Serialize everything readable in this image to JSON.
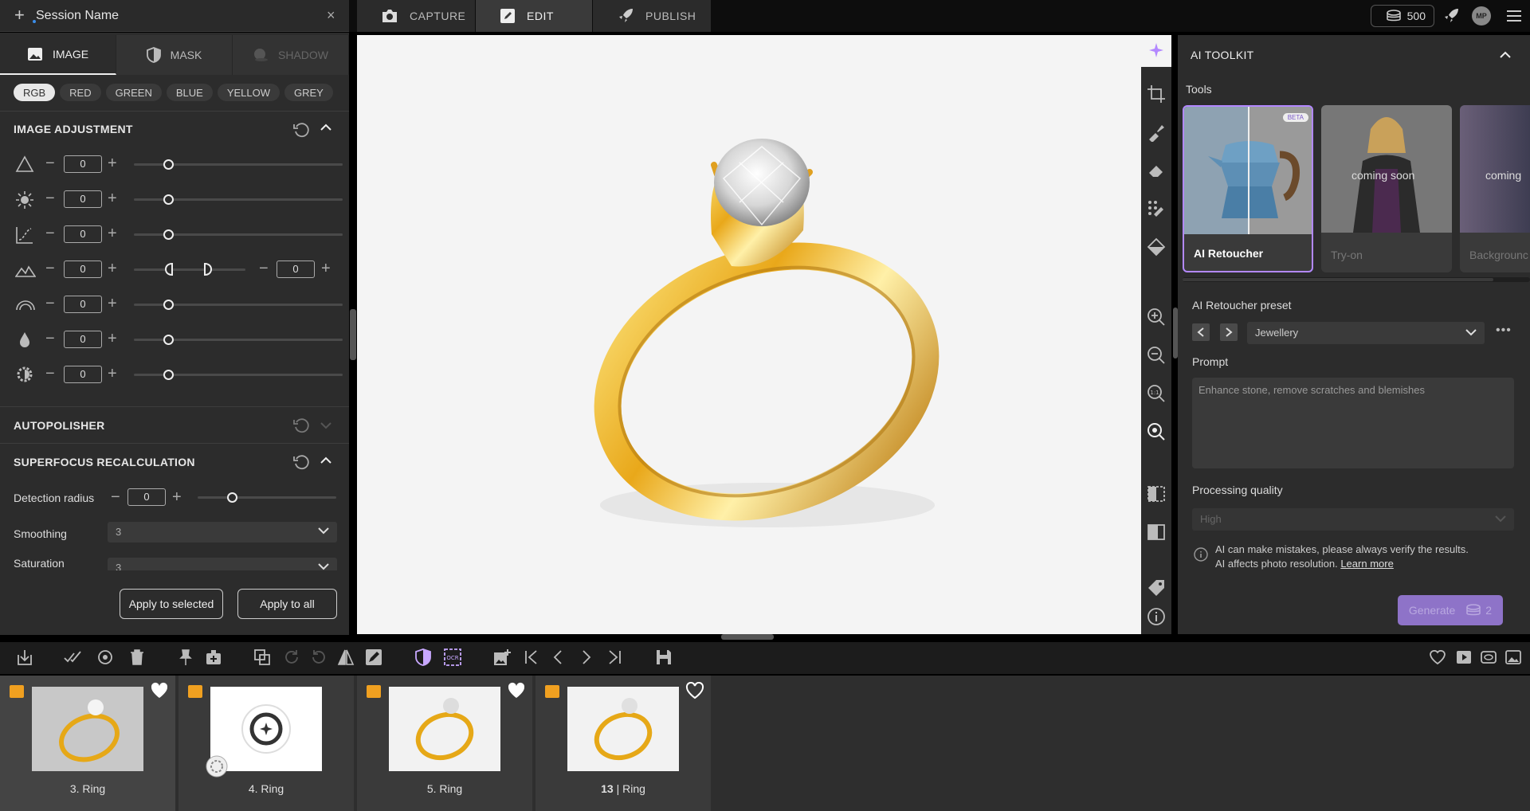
{
  "session": {
    "title": "Session Name"
  },
  "main_tabs": [
    {
      "label": "CAPTURE",
      "icon": "camera-icon"
    },
    {
      "label": "EDIT",
      "icon": "edit-icon"
    },
    {
      "label": "PUBLISH",
      "icon": "rocket-icon"
    }
  ],
  "credits": {
    "value": "500"
  },
  "avatar": {
    "initials": "MP"
  },
  "left_tabs": [
    {
      "label": "IMAGE",
      "icon": "image-icon"
    },
    {
      "label": "MASK",
      "icon": "shield-icon"
    },
    {
      "label": "SHADOW",
      "icon": "shadow-icon"
    }
  ],
  "channels": [
    "RGB",
    "RED",
    "GREEN",
    "BLUE",
    "YELLOW",
    "GREY"
  ],
  "image_adjustment": {
    "title": "IMAGE ADJUSTMENT",
    "rows": [
      {
        "icon": "triangle-icon",
        "value": "0"
      },
      {
        "icon": "brightness-icon",
        "value": "0"
      },
      {
        "icon": "curve-icon",
        "value": "0"
      },
      {
        "icon": "levels-icon",
        "value": "0",
        "value2": "0"
      },
      {
        "icon": "arc-icon",
        "value": "0"
      },
      {
        "icon": "drop-icon",
        "value": "0"
      },
      {
        "icon": "contrast-gear-icon",
        "value": "0"
      }
    ]
  },
  "autopolisher": {
    "title": "AUTOPOLISHER"
  },
  "superfocus": {
    "title": "SUPERFOCUS RECALCULATION",
    "detection_label": "Detection radius",
    "detection_value": "0",
    "smoothing_label": "Smoothing",
    "smoothing_value": "3",
    "saturation_label": "Saturation",
    "saturation_value": "3"
  },
  "buttons": {
    "apply_selected": "Apply to selected",
    "apply_all": "Apply to all"
  },
  "toolkit": {
    "title": "AI TOOLKIT",
    "tools_label": "Tools",
    "cards": [
      {
        "label": "AI Retoucher",
        "badge": "BETA",
        "overlay": ""
      },
      {
        "label": "Try-on",
        "badge": "",
        "overlay": "coming soon"
      },
      {
        "label": "Backgrounc",
        "badge": "",
        "overlay": "coming"
      }
    ],
    "preset_label": "AI Retoucher preset",
    "preset_value": "Jewellery",
    "prompt_label": "Prompt",
    "prompt_value": "Enhance stone, remove scratches and blemishes",
    "quality_label": "Processing quality",
    "quality_value": "High",
    "info_line1": "AI can make mistakes, please always verify the results.",
    "info_line2": "AI affects photo resolution.",
    "learn_more": "Learn more",
    "generate_label": "Generate",
    "generate_cost": "2"
  },
  "thumbnails": [
    {
      "caption": "3. Ring",
      "favorite": true
    },
    {
      "caption": "4. Ring",
      "favorite": false
    },
    {
      "caption": "5. Ring",
      "favorite": true
    },
    {
      "caption_num": "13",
      "caption_sep": "|",
      "caption_name": "Ring",
      "favorite": false
    }
  ],
  "colors": {
    "accent": "#b388ff",
    "gold": "#f0a020",
    "panel": "#2c2c2c"
  }
}
